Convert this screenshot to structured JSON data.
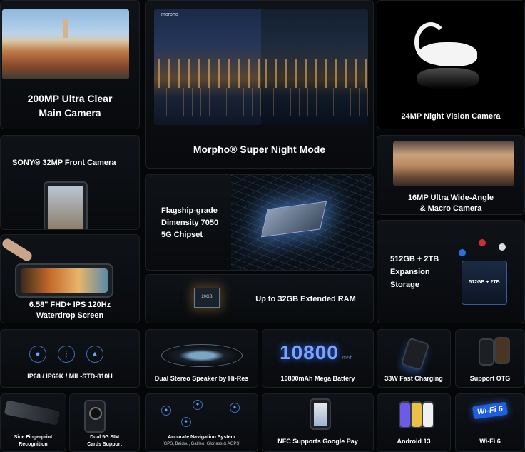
{
  "tiles": {
    "main_camera": {
      "line1": "200MP Ultra Clear",
      "line2": "Main Camera"
    },
    "night_mode": {
      "label": "Morpho® Super Night Mode",
      "watermark": "morpho"
    },
    "night_vision": {
      "label": "24MP Night Vision Camera"
    },
    "front_camera": {
      "label": "SONY® 32MP Front Camera"
    },
    "chipset": {
      "line1": "Flagship-grade",
      "line2": "Dimensity 7050",
      "line3": "5G Chipset"
    },
    "ultra_wide": {
      "line1": "16MP Ultra Wide-Angle",
      "line2": "& Macro Camera"
    },
    "screen": {
      "line1": "6.58\" FHD+ IPS 120Hz",
      "line2": "Waterdrop Screen"
    },
    "ram": {
      "label": "Up to 32GB Extended RAM",
      "chip_text": "20GB"
    },
    "storage": {
      "line1": "512GB + 2TB",
      "line2": "Expansion",
      "line3": "Storage",
      "badge": "512GB + 2TB"
    },
    "rugged": {
      "label": "IP68 / IP69K / MIL-STD-810H"
    },
    "speaker": {
      "label": "Dual Stereo Speaker by Hi-Res"
    },
    "battery": {
      "label": "10800mAh Mega Battery",
      "big_number": "10800",
      "unit": "mAh"
    },
    "charging": {
      "label": "33W Fast Charging"
    },
    "otg": {
      "label": "Support OTG"
    },
    "fingerprint": {
      "line1": "Side Fingerprint",
      "line2": "Recognition"
    },
    "dual_sim": {
      "line1": "Dual 5G SIM",
      "line2": "Cards Support"
    },
    "navigation": {
      "line1": "Accurate Navigation System",
      "line2": "(GPS, Beidou, Galileo, Glonass & AGPS)"
    },
    "nfc": {
      "label": "NFC Supports Google Pay"
    },
    "android": {
      "label": "Android 13"
    },
    "wifi": {
      "label": "Wi-Fi 6",
      "badge": "Wi-Fi 6"
    }
  },
  "colors": {
    "accent": "#3f7cff",
    "background": "#050608"
  }
}
